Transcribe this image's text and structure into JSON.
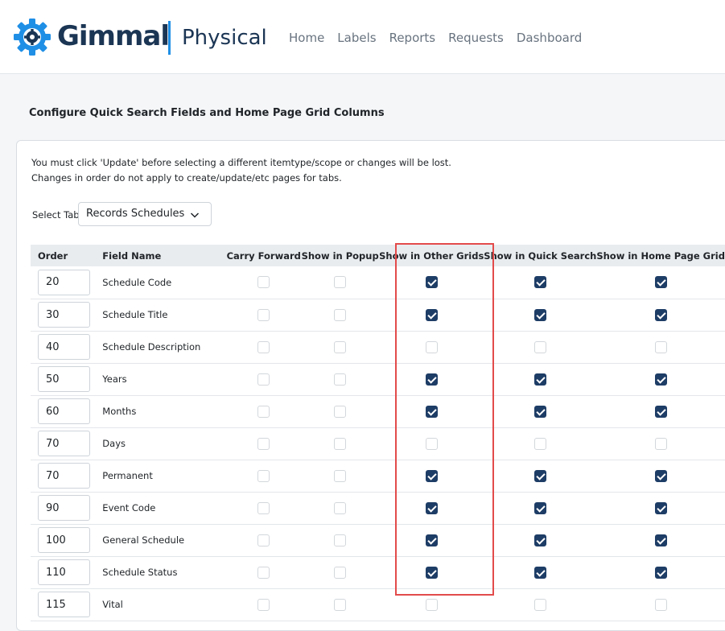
{
  "brand": {
    "name": "Gimmal",
    "product": "Physical",
    "accent_color": "#1f8fe6",
    "brand_color": "#1b3554"
  },
  "nav": [
    {
      "label": "Home"
    },
    {
      "label": "Labels"
    },
    {
      "label": "Reports"
    },
    {
      "label": "Requests"
    },
    {
      "label": "Dashboard"
    }
  ],
  "page": {
    "title": "Configure Quick Search Fields and Home Page Grid Columns"
  },
  "notes": {
    "line1": "You must click 'Update' before selecting a different itemtype/scope or changes will be lost.",
    "line2": "Changes in order do not apply to create/update/etc pages for tabs."
  },
  "tab_select": {
    "label": "Select Tab:",
    "value": "Records Schedules",
    "icon": "chevron-down-icon"
  },
  "table": {
    "headers": [
      "Order",
      "Field Name",
      "Carry Forward",
      "Show in Popup",
      "Show in Other Grids",
      "Show in Quick Search",
      "Show in Home Page Grid"
    ],
    "highlighted_column": "Show in Other Grids",
    "checkbox_color": "#1e3d66",
    "rows": [
      {
        "order": "20",
        "field": "Schedule Code",
        "carry_forward": false,
        "popup": false,
        "other_grids": true,
        "quick_search": true,
        "home_grid": true
      },
      {
        "order": "30",
        "field": "Schedule Title",
        "carry_forward": false,
        "popup": false,
        "other_grids": true,
        "quick_search": true,
        "home_grid": true
      },
      {
        "order": "40",
        "field": "Schedule Description",
        "carry_forward": false,
        "popup": false,
        "other_grids": false,
        "quick_search": false,
        "home_grid": false
      },
      {
        "order": "50",
        "field": "Years",
        "carry_forward": false,
        "popup": false,
        "other_grids": true,
        "quick_search": true,
        "home_grid": true
      },
      {
        "order": "60",
        "field": "Months",
        "carry_forward": false,
        "popup": false,
        "other_grids": true,
        "quick_search": true,
        "home_grid": true
      },
      {
        "order": "70",
        "field": "Days",
        "carry_forward": false,
        "popup": false,
        "other_grids": false,
        "quick_search": false,
        "home_grid": false
      },
      {
        "order": "70",
        "field": "Permanent",
        "carry_forward": false,
        "popup": false,
        "other_grids": true,
        "quick_search": true,
        "home_grid": true
      },
      {
        "order": "90",
        "field": "Event Code",
        "carry_forward": false,
        "popup": false,
        "other_grids": true,
        "quick_search": true,
        "home_grid": true
      },
      {
        "order": "100",
        "field": "General Schedule",
        "carry_forward": false,
        "popup": false,
        "other_grids": true,
        "quick_search": true,
        "home_grid": true
      },
      {
        "order": "110",
        "field": "Schedule Status",
        "carry_forward": false,
        "popup": false,
        "other_grids": true,
        "quick_search": true,
        "home_grid": true
      },
      {
        "order": "115",
        "field": "Vital",
        "carry_forward": false,
        "popup": false,
        "other_grids": false,
        "quick_search": false,
        "home_grid": false
      }
    ]
  }
}
